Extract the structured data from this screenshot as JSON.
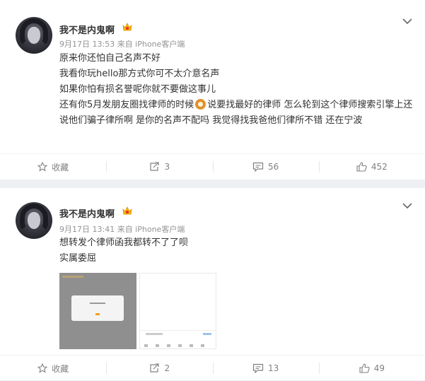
{
  "posts": [
    {
      "username": "我不是内鬼啊",
      "meta": "9月17日 13:53 来自 iPhone客户端",
      "lines": [
        "原来你还怕自己名声不好",
        "我看你玩hello那方式你可不太介意名声",
        "如果你怕有损名誉呢你就不要做这事儿"
      ],
      "line4_before": "还有你5月发朋友圈找律师的时候",
      "line4_after": "说要找最好的律师 怎么轮到这个律师搜索引擎上还说他们骗子律所啊 是你的名声不配吗 我觉得找我爸他们律所不错 还在宁波",
      "actions": {
        "favorite": "收藏",
        "repost": "3",
        "comment": "56",
        "like": "452"
      }
    },
    {
      "username": "我不是内鬼啊",
      "meta": "9月17日 13:41 来自 iPhone客户端",
      "lines": [
        "想转发个律师函我都转不了了呗",
        "实属委屈"
      ],
      "actions": {
        "favorite": "收藏",
        "repost": "2",
        "comment": "13",
        "like": "49"
      }
    }
  ],
  "icons": {
    "avatar": "avatar-anime-dark",
    "badge": "crown-badge-icon",
    "menu": "chevron-down-icon",
    "favorite": "star-icon",
    "repost": "repost-icon",
    "comment": "comment-icon",
    "like": "thumbs-up-icon"
  },
  "colors": {
    "background": "#eef0f3",
    "badge": "#f5b400",
    "meta": "#939393"
  }
}
